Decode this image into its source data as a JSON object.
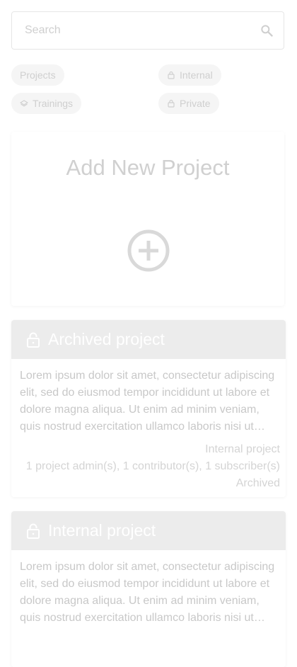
{
  "search": {
    "placeholder": "Search",
    "icon": "search-icon"
  },
  "filters": [
    {
      "label": "Projects",
      "icon": ""
    },
    {
      "label": "Internal",
      "icon": "lock-icon"
    },
    {
      "label": "Trainings",
      "icon": "layers-icon"
    },
    {
      "label": "Private",
      "icon": "lock-icon"
    }
  ],
  "add_card": {
    "title": "Add New Project",
    "icon": "add-circle-icon"
  },
  "projects": [
    {
      "title": "Archived project",
      "icon": "lock-open-icon",
      "description": "Lorem ipsum dolor sit amet, consectetur adipiscing elit, sed do eiusmod tempor incididunt ut labore et dolore magna aliqua. Ut enim ad minim veniam, quis nostrud exercitation ullamco laboris nisi ut aliquip ex ea commodo consequat.",
      "type": "Internal project",
      "members": "1 project admin(s), 1 contributor(s), 1 subscriber(s)",
      "status": "Archived"
    },
    {
      "title": "Internal project",
      "icon": "lock-open-icon",
      "description": "Lorem ipsum dolor sit amet, consectetur adipiscing elit, sed do eiusmod tempor incididunt ut labore et dolore magna aliqua. Ut enim ad minim veniam, quis nostrud exercitation ullamco laboris nisi ut aliquip ex ea commodo consequat."
    }
  ]
}
